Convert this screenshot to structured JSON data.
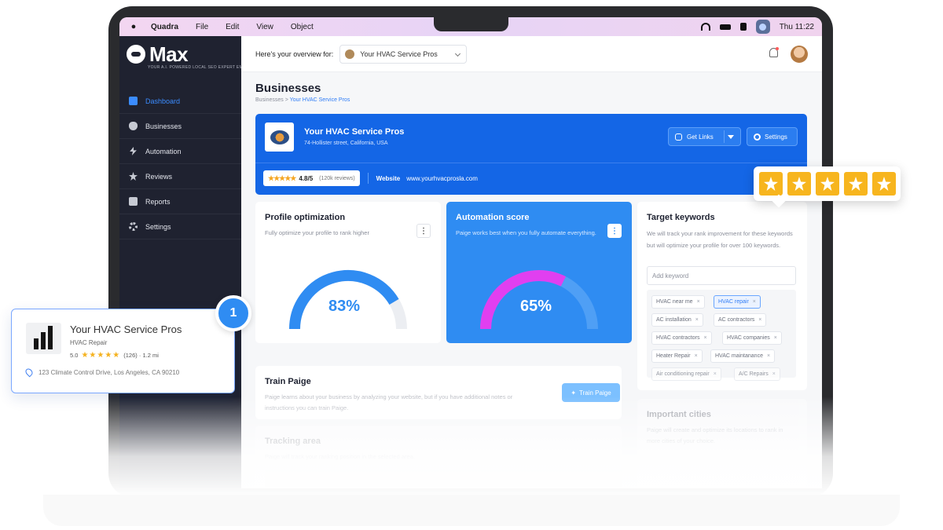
{
  "menubar": {
    "app": "Quadra",
    "items": [
      "File",
      "Edit",
      "View",
      "Object"
    ],
    "clock": "Thu 11:22"
  },
  "sidebar": {
    "logo_text": "Max",
    "tagline": "YOUR A.I. POWERED LOCAL SEO EXPERT EMPL",
    "items": [
      {
        "label": "Dashboard",
        "icon": "dashboard-icon",
        "active": true
      },
      {
        "label": "Businesses",
        "icon": "shield-icon"
      },
      {
        "label": "Automation",
        "icon": "bolt-icon"
      },
      {
        "label": "Reviews",
        "icon": "star-icon"
      },
      {
        "label": "Reports",
        "icon": "reports-icon"
      },
      {
        "label": "Settings",
        "icon": "gear-icon"
      }
    ]
  },
  "topbar": {
    "overview_label": "Here's your overview for:",
    "selected_business": "Your HVAC Service Pros"
  },
  "page": {
    "title": "Businesses",
    "breadcrumb_root": "Businesses",
    "breadcrumb_sep": ">",
    "breadcrumb_current": "Your HVAC Service Pros"
  },
  "business": {
    "name": "Your HVAC Service Pros",
    "address": "74-Hollister street, California, USA",
    "get_links_label": "Get Links",
    "settings_label": "Settings",
    "stars": "★★★★★",
    "rating": "4.8/5",
    "reviews": "(120k reviews)",
    "website_label": "Website",
    "website": "www.yourhvacprosla.com"
  },
  "profile_card": {
    "title": "Profile optimization",
    "subtitle": "Fully optimize your profile to rank higher",
    "value_text": "83%",
    "value": 0.83
  },
  "automation_card": {
    "title": "Automation score",
    "subtitle": "Paige works best when you fully automate everything.",
    "value_text": "65%",
    "value": 0.65
  },
  "keywords_card": {
    "title": "Target keywords",
    "subtitle": "We will track your rank improvement for these keywords but will optimize your profile for over 100 keywords.",
    "input_placeholder": "Add keyword",
    "chips": [
      "HVAC near me",
      "HVAC repair",
      "AC installation",
      "AC contractors",
      "HVAC contractors",
      "HVAC companies",
      "Heater Repair",
      "HVAC maintanance",
      "Air conditioning repair",
      "A/C Repairs"
    ],
    "selected_chip": "HVAC repair"
  },
  "train_card": {
    "title": "Train Paige",
    "text": "Paige learns about your business by analyzing your website, but if you have additional notes or instructions you can train Paige.",
    "button": "Train Paige"
  },
  "tracking_card": {
    "title": "Tracking area",
    "text": "Paige will track your ranking position in the selected area."
  },
  "cities_card": {
    "title": "Important cities",
    "text": "Paige will create and optimize its locations to rank in more cities of your choice."
  },
  "listing": {
    "name": "Your HVAC Service Pros",
    "category": "HVAC Repair",
    "rating": "5.0",
    "stars": "★★★★★",
    "reviews_distance": "(126) · 1.2 mi",
    "address": "123 Climate Control Drive, Los Angeles, CA 90210",
    "badge": "1"
  },
  "colors": {
    "accent": "#1466e6",
    "gauge_blue": "#2f8cf2",
    "gauge_magenta": "#e13ff0",
    "star": "#f7b51e",
    "sidebar_bg": "#1f2230"
  }
}
